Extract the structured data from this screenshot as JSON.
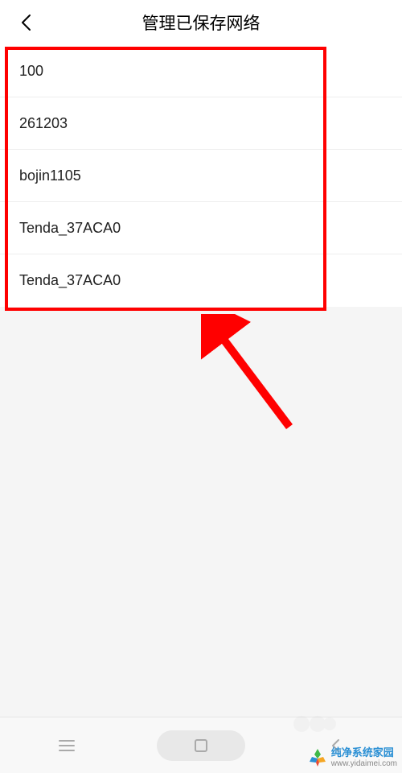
{
  "header": {
    "title": "管理已保存网络"
  },
  "networks": {
    "items": [
      {
        "name": "100"
      },
      {
        "name": "261203"
      },
      {
        "name": "bojin1105"
      },
      {
        "name": "Tenda_37ACA0"
      },
      {
        "name": "Tenda_37ACA0"
      }
    ]
  },
  "annotation": {
    "box_color": "#ff0000",
    "arrow_color": "#ff0000"
  },
  "watermark": {
    "brand": "纯净系统家园",
    "url": "www.yidaimei.com"
  }
}
